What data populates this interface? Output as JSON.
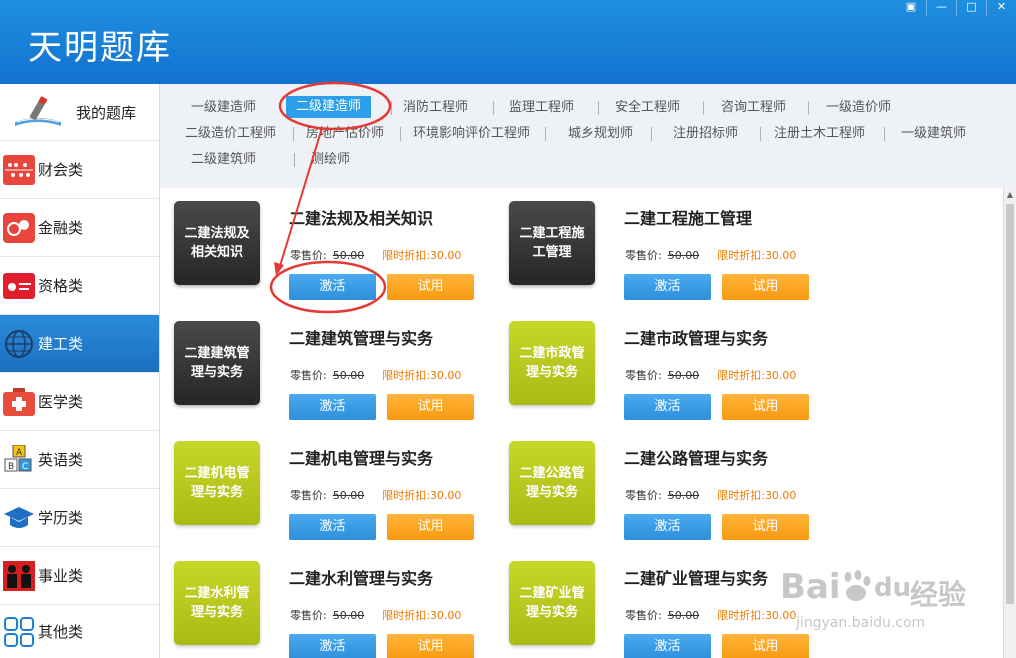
{
  "app": {
    "title": "天明题库"
  },
  "window_controls": [
    "▣",
    "—",
    "□",
    "✕"
  ],
  "sidebar": {
    "mytiku": "我的题库",
    "items": [
      {
        "label": "财会类",
        "icon": "abacus-icon"
      },
      {
        "label": "金融类",
        "icon": "finance-icon"
      },
      {
        "label": "资格类",
        "icon": "id-card-icon"
      },
      {
        "label": "建工类",
        "icon": "globe-icon",
        "active": true
      },
      {
        "label": "医学类",
        "icon": "medical-kit-icon"
      },
      {
        "label": "英语类",
        "icon": "abc-blocks-icon"
      },
      {
        "label": "学历类",
        "icon": "graduation-cap-icon"
      },
      {
        "label": "事业类",
        "icon": "people-icon"
      },
      {
        "label": "其他类",
        "icon": "grid-icon"
      }
    ]
  },
  "tabs": {
    "row1": [
      "一级建造师",
      "二级建造师",
      "消防工程师",
      "监理工程师",
      "安全工程师",
      "咨询工程师",
      "一级造价师"
    ],
    "row2": [
      "二级造价工程师",
      "房地产估价师",
      "环境影响评价工程师",
      "城乡规划师",
      "注册招标师",
      "注册土木工程师",
      "一级建筑师"
    ],
    "row3": [
      "二级建筑师",
      "测绘师"
    ],
    "active": "二级建造师"
  },
  "products": [
    {
      "cover": "二建法规及相关知识",
      "title": "二建法规及相关知识",
      "theme": "dark"
    },
    {
      "cover": "二建工程施工管理",
      "title": "二建工程施工管理",
      "theme": "dark"
    },
    {
      "cover": "二建建筑管理与实务",
      "title": "二建建筑管理与实务",
      "theme": "dark"
    },
    {
      "cover": "二建市政管理与实务",
      "title": "二建市政管理与实务",
      "theme": "green"
    },
    {
      "cover": "二建机电管理与实务",
      "title": "二建机电管理与实务",
      "theme": "green"
    },
    {
      "cover": "二建公路管理与实务",
      "title": "二建公路管理与实务",
      "theme": "green"
    },
    {
      "cover": "二建水利管理与实务",
      "title": "二建水利管理与实务",
      "theme": "green"
    },
    {
      "cover": "二建矿业管理与实务",
      "title": "二建矿业管理与实务",
      "theme": "green"
    }
  ],
  "pricing": {
    "retail_label": "零售价:",
    "retail_value": "50.00",
    "discount_label": "限时折扣:",
    "discount_value": "30.00"
  },
  "buttons": {
    "activate": "激活",
    "trial": "试用"
  },
  "colors": {
    "header": "#1478d4",
    "active_tab": "#2d9ee9",
    "activate_btn": "#3a9be6",
    "trial_btn": "#f9a623",
    "discount_text": "#f07a00",
    "annotation": "#e53935"
  },
  "watermark": {
    "brand": "Bai",
    "brand2": "du",
    "cn": "经验",
    "url": "jingyan.baidu.com"
  }
}
